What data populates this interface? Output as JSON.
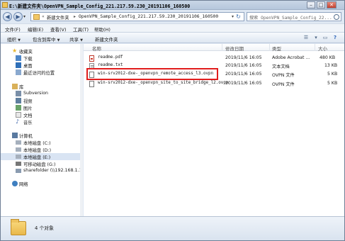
{
  "window": {
    "title": "E:\\新建文件夹\\OpenVPN_Sample_Config_221.217.59.230_20191106_160500",
    "minimize": "–",
    "maximize": "□",
    "close": "✕"
  },
  "address": {
    "crumbs": [
      "新建文件夹",
      "OpenVPN_Sample_Config_221.217.59.230_20191106_160500"
    ],
    "separator": "▸",
    "root_separator": "«",
    "search_placeholder": "搜索 OpenVPN_Sample_Config_22..."
  },
  "menu": [
    "文件(F)",
    "编辑(E)",
    "查看(V)",
    "工具(T)",
    "帮助(H)"
  ],
  "commands": {
    "organize": "组织",
    "include_in_library": "包含到库中",
    "share": "共享",
    "new_folder": "新建文件夹"
  },
  "nav": {
    "favorites": "收藏夹",
    "downloads": "下载",
    "desktop": "桌面",
    "recent": "最近访问的位置",
    "library": "库",
    "subversion": "Subversion",
    "videos": "视频",
    "pictures": "图片",
    "documents": "文档",
    "music": "音乐",
    "computer": "计算机",
    "disk_c": "本地磁盘 (C:)",
    "disk_d": "本地磁盘 (D:)",
    "disk_e": "本地磁盘 (E:)",
    "removable": "可移动磁盘 (G:)",
    "sharefolder": "sharefolder (\\\\192.168.1.1",
    "network": "网络"
  },
  "columns": {
    "name": "名称",
    "date": "修改日期",
    "type": "类型",
    "size": "大小"
  },
  "files": [
    {
      "name": "readme.pdf",
      "date": "2019/11/6 16:05",
      "type": "Adobe Acrobat ...",
      "size": "480 KB",
      "icon": "pdf"
    },
    {
      "name": "readme.txt",
      "date": "2019/11/6 16:05",
      "type": "文本文档",
      "size": "13 KB",
      "icon": "txt"
    },
    {
      "name": "win-srv2012-dxe-_openvpn_remote_access_l3.ovpn",
      "date": "2019/11/6 16:05",
      "type": "OVPN 文件",
      "size": "5 KB",
      "icon": "ovpn"
    },
    {
      "name": "win-srv2012-dxe-_openvpn_site_to_site_bridge_l2.ovpn",
      "date": "2019/11/6 16:05",
      "type": "OVPN 文件",
      "size": "5 KB",
      "icon": "ovpn"
    }
  ],
  "status": {
    "count": "4 个对象"
  },
  "colors": {
    "highlight": "#e11d1d",
    "folder": "#f2c867"
  }
}
